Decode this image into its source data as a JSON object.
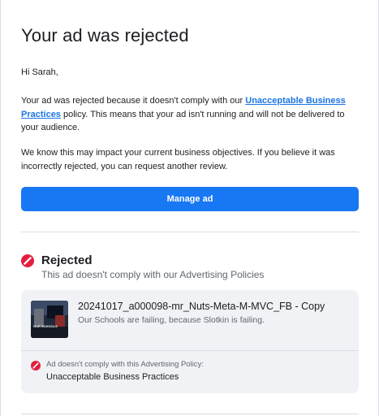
{
  "email": {
    "title": "Your ad was rejected",
    "greeting": "Hi Sarah,",
    "paragraph1": {
      "before_link": "Your ad was rejected because it doesn't comply with our ",
      "link_text": "Unacceptable Business Practices",
      "after_link": " policy. This means that your ad isn't running and will not be delivered to your audience."
    },
    "paragraph2": "We know this may impact your current business objectives. If you believe it was incorrectly rejected, you can request another review.",
    "manage_button_label": "Manage ad"
  },
  "status": {
    "title": "Rejected",
    "subtitle": "This ad doesn't comply with our Advertising Policies",
    "icon": "rejected-icon",
    "color": "#e41e3f"
  },
  "ad": {
    "name": "20241017_a000098-mr_Nuts-Meta-M-MVC_FB - Copy",
    "text": "Our Schools are failing, because Slotkin is failing.",
    "thumbnail_caption": "OUR SCHOOLS"
  },
  "policy": {
    "label": "Ad doesn't comply with this Advertising Policy:",
    "name": "Unacceptable Business Practices",
    "icon": "rejected-icon"
  },
  "colors": {
    "primary_button": "#1877f2",
    "link": "#1b74e4",
    "card_background": "#f0f2f5",
    "rejected": "#e41e3f"
  }
}
